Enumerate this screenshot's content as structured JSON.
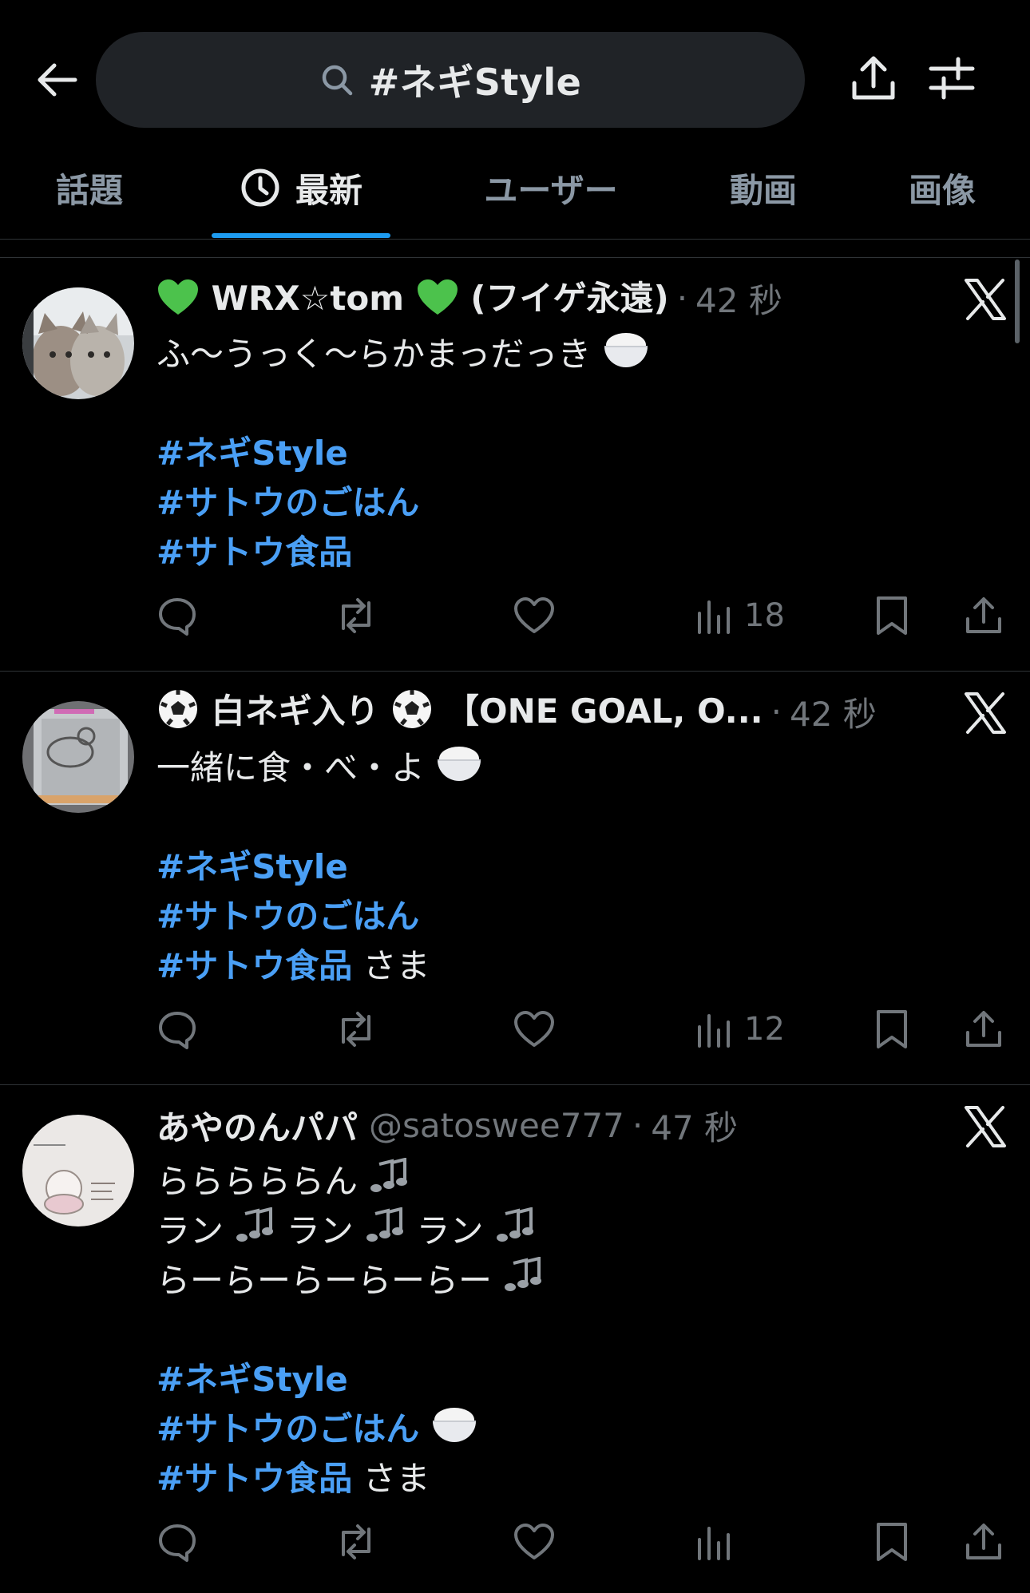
{
  "search": {
    "query": "#ネギStyle"
  },
  "tabs": [
    {
      "label": "話題"
    },
    {
      "label": "最新"
    },
    {
      "label": "ユーザー"
    },
    {
      "label": "動画"
    },
    {
      "label": "画像"
    }
  ],
  "active_tab": "最新",
  "colors": {
    "accent": "#1d9bf0",
    "hashtag": "#4a9ff5",
    "muted": "#71767b",
    "background": "#000000"
  },
  "posts": [
    {
      "name_prefix_emoji": "green-heart",
      "name_text": "WRX☆tom",
      "name_suffix_emoji": "green-heart",
      "name_tail": "(フイゲ永遠)",
      "handle": "",
      "time": "42 秒",
      "text_line_1": "ふ〜うっく〜らかまっだっき",
      "tags": [
        "#ネギStyle",
        "#サトウのごはん",
        "#サトウ食品"
      ],
      "views": "18"
    },
    {
      "name_prefix_emoji": "soccer-ball",
      "name_text": "白ネギ入り",
      "name_suffix_emoji": "soccer-ball",
      "name_tail": "【ONE GOAL, O...",
      "handle": "",
      "time": "42 秒",
      "text_line_1": "一緒に食・べ・よ",
      "tags": [
        "#ネギStyle",
        "#サトウのごはん",
        "#サトウ食品"
      ],
      "tail_text": " さま",
      "views": "12"
    },
    {
      "name_text": "あやのんパパ",
      "handle": "@satoswee777",
      "time": "47 秒",
      "text_line_1": "らららららん",
      "text_line_2": "ラン",
      "text_line_2b": "ラン",
      "text_line_2c": "ラン",
      "text_line_3": "らーらーらーらーらー",
      "tags": [
        "#ネギStyle",
        "#サトウのごはん",
        "#サトウ食品"
      ],
      "tail_text": " さま",
      "views": ""
    }
  ]
}
